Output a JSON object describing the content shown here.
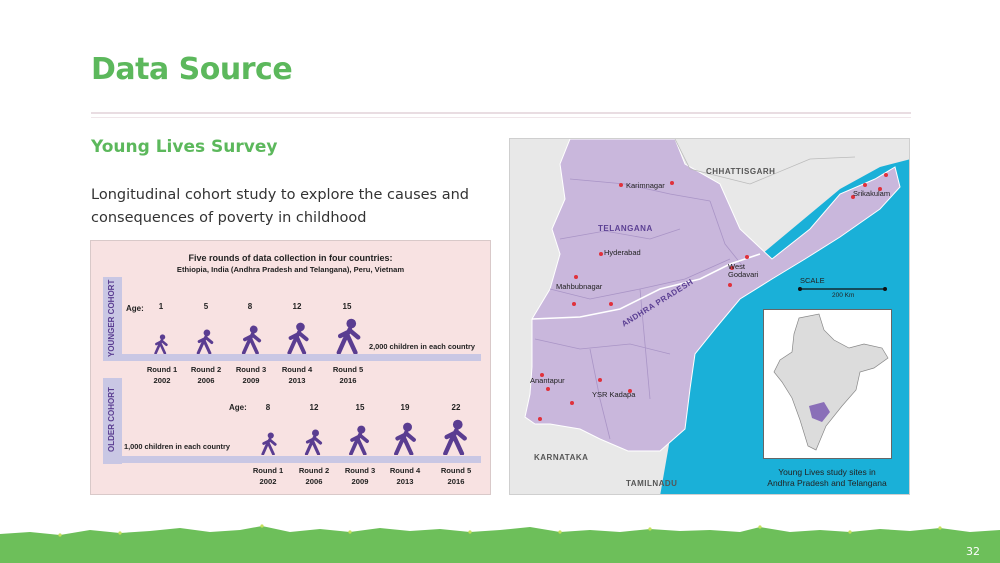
{
  "slide": {
    "title": "Data Source",
    "subtitle": "Young Lives Survey",
    "description": "Longitudinal cohort study to explore the causes and consequences of poverty in childhood",
    "page_number": "32"
  },
  "infographic": {
    "heading": "Five rounds of data collection in four countries:",
    "subheading": "Ethiopia, India (Andhra Pradesh and Telangana), Peru, Vietnam",
    "younger_cohort": {
      "label": "YOUNGER COHORT",
      "age_label": "Age:",
      "ages": [
        "1",
        "5",
        "8",
        "12",
        "15"
      ],
      "note": "2,000 children in each country",
      "rounds": [
        {
          "name": "Round 1",
          "year": "2002"
        },
        {
          "name": "Round 2",
          "year": "2006"
        },
        {
          "name": "Round 3",
          "year": "2009"
        },
        {
          "name": "Round 4",
          "year": "2013"
        },
        {
          "name": "Round 5",
          "year": "2016"
        }
      ]
    },
    "older_cohort": {
      "label": "OLDER COHORT",
      "age_label": "Age:",
      "ages": [
        "8",
        "12",
        "15",
        "19",
        "22"
      ],
      "note": "1,000 children in each country",
      "rounds": [
        {
          "name": "Round 1",
          "year": "2002"
        },
        {
          "name": "Round 2",
          "year": "2006"
        },
        {
          "name": "Round 3",
          "year": "2009"
        },
        {
          "name": "Round 4",
          "year": "2013"
        },
        {
          "name": "Round 5",
          "year": "2016"
        }
      ]
    }
  },
  "map": {
    "states": {
      "chhattisgarh": "CHHATTISGARH",
      "telangana": "TELANGANA",
      "andhra": "ANDHRA PRADESH",
      "karnataka": "KARNATAKA",
      "tamilnadu": "TAMILNADU"
    },
    "districts": {
      "karimnagar": "Karimnagar",
      "hyderabad": "Hyderabad",
      "mahbubnagar": "Mahbubnagar",
      "west_godavari_1": "West",
      "west_godavari_2": "Godavari",
      "srikakulam": "Srikakulam",
      "anantapur": "Anantapur",
      "ysr_kadapa": "YSR Kadapa"
    },
    "scale_label": "SCALE",
    "scale_value": "200 Km",
    "caption_line1": "Young Lives study sites in",
    "caption_line2": "Andhra Pradesh and Telangana",
    "colors": {
      "sea": "#1ab0d8",
      "state_fill": "#c9b7dc",
      "other_land": "#e8e8e8",
      "dot": "#e0313b"
    }
  },
  "theme": {
    "accent_green": "#5cb85c",
    "cohort_purple": "#5a3d91"
  }
}
